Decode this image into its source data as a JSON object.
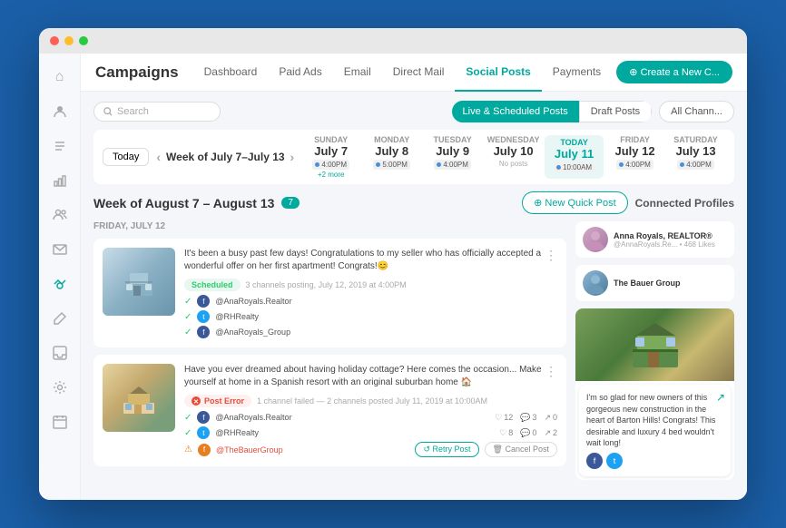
{
  "browser": {
    "dots": [
      "red",
      "yellow",
      "green"
    ]
  },
  "sidebar": {
    "icons": [
      {
        "name": "home-icon",
        "symbol": "⌂",
        "active": false
      },
      {
        "name": "user-icon",
        "symbol": "👤",
        "active": false
      },
      {
        "name": "list-icon",
        "symbol": "☰",
        "active": false
      },
      {
        "name": "chart-icon",
        "symbol": "📊",
        "active": false
      },
      {
        "name": "contact-icon",
        "symbol": "👥",
        "active": false
      },
      {
        "name": "mail-icon",
        "symbol": "✉",
        "active": false
      },
      {
        "name": "megaphone-icon",
        "symbol": "📣",
        "active": true
      },
      {
        "name": "edit-icon",
        "symbol": "✏",
        "active": false
      },
      {
        "name": "inbox-icon",
        "symbol": "📥",
        "active": false
      },
      {
        "name": "settings-icon",
        "symbol": "⚙",
        "active": false
      },
      {
        "name": "calendar-icon",
        "symbol": "📅",
        "active": false
      }
    ]
  },
  "topnav": {
    "title": "Campaigns",
    "items": [
      {
        "label": "Dashboard",
        "active": false
      },
      {
        "label": "Paid Ads",
        "active": false
      },
      {
        "label": "Email",
        "active": false
      },
      {
        "label": "Direct Mail",
        "active": false
      },
      {
        "label": "Social Posts",
        "active": true
      },
      {
        "label": "Payments",
        "active": false
      }
    ],
    "create_button": "⊕ Create a New C..."
  },
  "toolbar": {
    "search_placeholder": "Search",
    "tab_live": "Live & Scheduled Posts",
    "tab_draft": "Draft Posts",
    "all_channels": "All Chann..."
  },
  "calendar": {
    "today_label": "Today",
    "week_label": "Week of July 7–July 13",
    "days": [
      {
        "name": "SUNDAY",
        "date": "July 7",
        "events": [
          "4:00PM"
        ],
        "dots": [
          "blue",
          "teal"
        ],
        "more": "+2 more",
        "today": false
      },
      {
        "name": "MONDAY",
        "date": "July 8",
        "events": [
          "5:00PM"
        ],
        "dots": [
          "blue",
          "teal"
        ],
        "today": false
      },
      {
        "name": "TUESDAY",
        "date": "July 9",
        "events": [
          "4:00PM"
        ],
        "dots": [
          "blue",
          "teal"
        ],
        "today": false
      },
      {
        "name": "WEDNESDAY",
        "date": "July 10",
        "events": [],
        "no_posts": "No posts",
        "today": false
      },
      {
        "name": "TODAY",
        "date": "July 11",
        "events": [
          "10:00AM"
        ],
        "dots": [
          "blue",
          "teal"
        ],
        "today": true
      },
      {
        "name": "FRIDAY",
        "date": "July 12",
        "events": [
          "4:00PM"
        ],
        "dots": [
          "blue",
          "teal"
        ],
        "today": false
      },
      {
        "name": "SATURDAY",
        "date": "July 13",
        "events": [
          "4:00PM"
        ],
        "today": false
      }
    ]
  },
  "week_section": {
    "label": "Week of August 7 – August 13",
    "count": "7",
    "quick_post_btn": "⊕ New Quick Post",
    "connected_profiles": "Connected Profiles"
  },
  "posts": {
    "day_label": "FRIDAY, JULY 12",
    "items": [
      {
        "id": "post-1",
        "text": "It's been a busy past few days! Congratulations to my seller who has officially accepted a wonderful offer on her first apartment! Congrats!😊",
        "status": "Scheduled",
        "meta": "3 channels posting, July 12, 2019 at 4:00PM",
        "channels": [
          {
            "type": "fb",
            "name": "@AnaRoyals.Realtor",
            "check": true
          },
          {
            "type": "tw",
            "name": "@RHRealty",
            "check": true
          },
          {
            "type": "fb",
            "name": "@AnaRoyals_Group",
            "check": true
          }
        ]
      },
      {
        "id": "post-2",
        "text": "Have you ever dreamed about having holiday cottage? Here comes the occasion... Make yourself at home in a Spanish resort with an original suburban home 🏠",
        "status_error": "Post Error",
        "meta_error": "1 channel failed — 2 channels posted July 11, 2019 at 10:00AM",
        "channels": [
          {
            "type": "fb",
            "name": "@AnaRoyals.Realtor",
            "check": true,
            "likes": 12,
            "comments": 3,
            "shares": 0
          },
          {
            "type": "tw",
            "name": "@RHRealty",
            "check": true,
            "likes": 8,
            "comments": 0,
            "shares": 2
          },
          {
            "type": "fb",
            "name": "@TheBauerGroup",
            "check": false,
            "warn": true
          }
        ],
        "actions": {
          "retry": "↺ Retry Post",
          "cancel": "🗑 Cancel Post"
        }
      }
    ]
  },
  "right_panel": {
    "profiles": [
      {
        "name": "Anna Royals, REALTOR®",
        "handle": "@AnnaRoyals.Re... • 468 Likes"
      },
      {
        "name": "The Bauer Group",
        "handle": ""
      }
    ],
    "house_post": {
      "text": "I'm so glad for new owners of this gorgeous new construction in the heart of Barton Hills! Congrats! This desirable and luxury 4 bed wouldn't wait long!"
    }
  }
}
